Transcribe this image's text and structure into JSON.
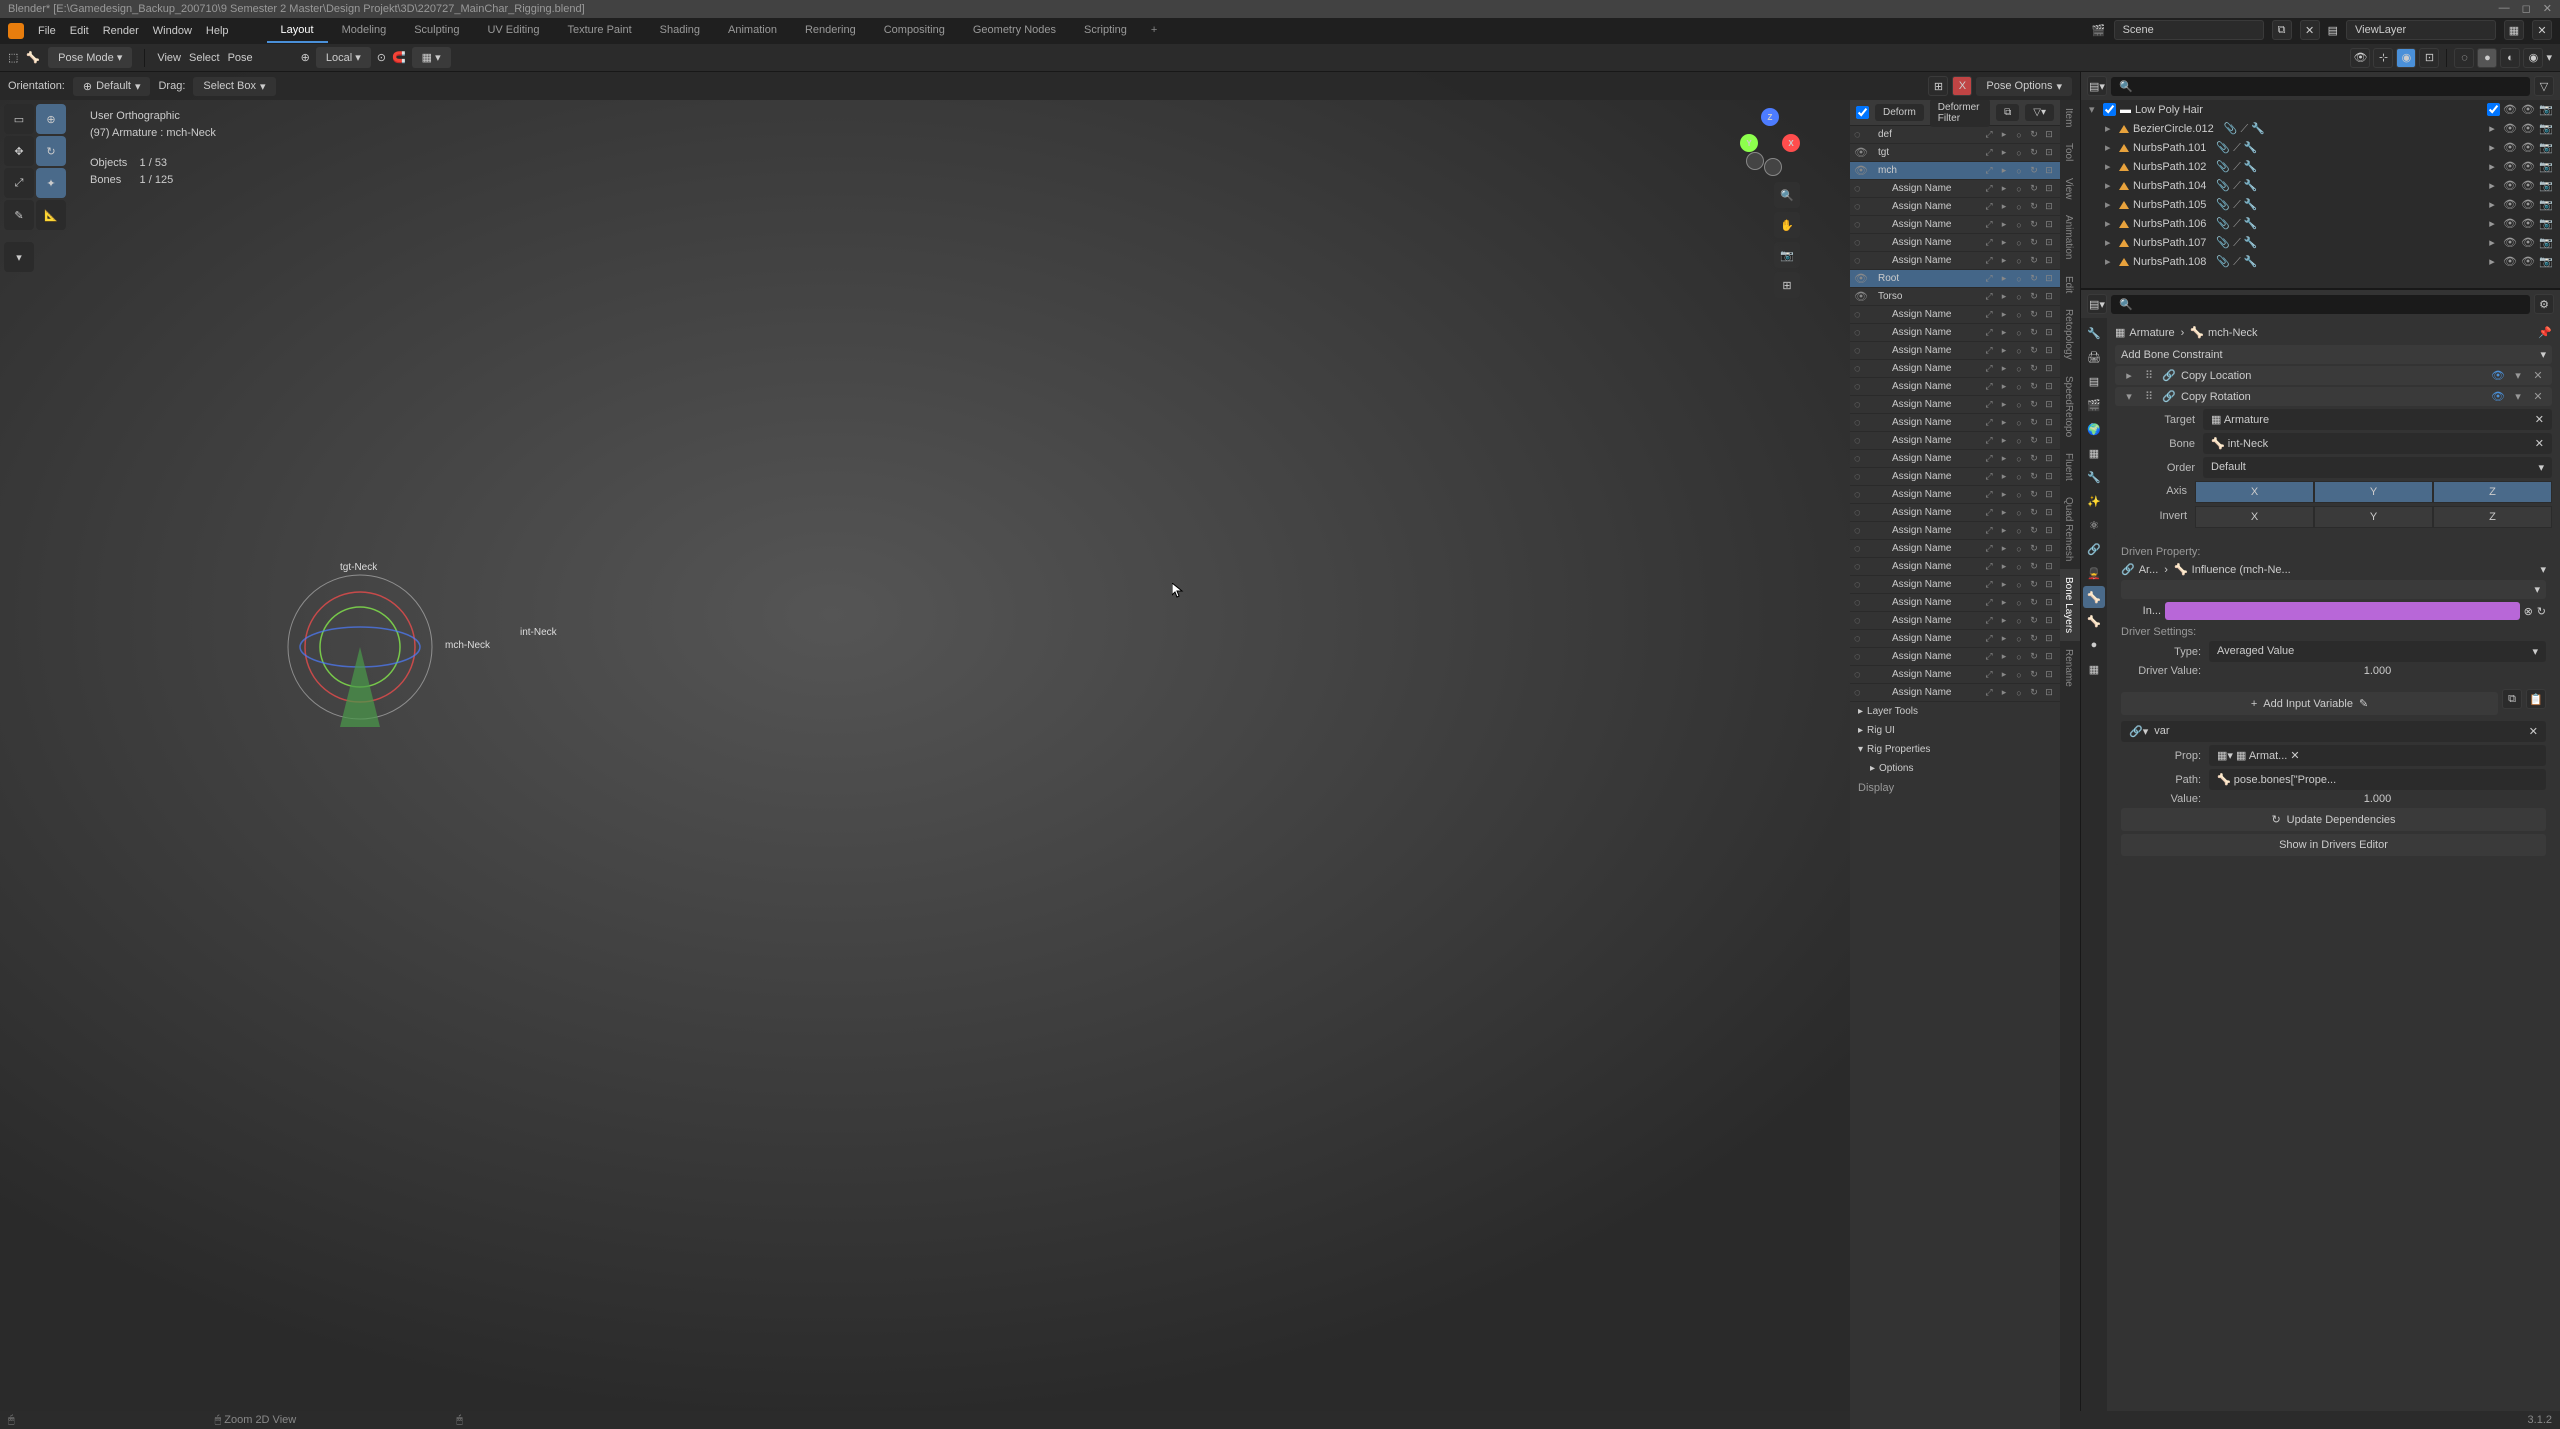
{
  "title": "Blender* [E:\\Gamedesign_Backup_200710\\9 Semester 2 Master\\Design Projekt\\3D\\220727_MainChar_Rigging.blend]",
  "menu": [
    "File",
    "Edit",
    "Render",
    "Window",
    "Help"
  ],
  "workspaces": [
    "Layout",
    "Modeling",
    "Sculpting",
    "UV Editing",
    "Texture Paint",
    "Shading",
    "Animation",
    "Rendering",
    "Compositing",
    "Geometry Nodes",
    "Scripting"
  ],
  "active_ws": "Layout",
  "scene": "Scene",
  "viewlayer": "ViewLayer",
  "header": {
    "mode": "Pose Mode",
    "menus": [
      "View",
      "Select",
      "Pose"
    ],
    "orient": "Local"
  },
  "orientbar": {
    "label": "Orientation:",
    "value": "Default",
    "drag": "Drag:",
    "dragval": "Select Box"
  },
  "n_header": {
    "deform": "Deform",
    "filter": "Deformer Filter"
  },
  "pose_options": "Pose Options",
  "vp": {
    "l1": "User Orthographic",
    "l2": "(97) Armature : mch-Neck",
    "objects_lbl": "Objects",
    "objects": "1 / 53",
    "bones_lbl": "Bones",
    "bones": "1 / 125",
    "bone_labels": [
      "tgt-Neck",
      "int-Neck",
      "mch-Neck"
    ]
  },
  "n_tabs": [
    "Item",
    "Tool",
    "View",
    "Animation",
    "Edit",
    "Retopology",
    "SpeedRetopo",
    "Fluent",
    "Quad Remesh",
    "Bone Layers",
    "Rename"
  ],
  "layers": {
    "top": [
      {
        "name": "def",
        "eye": false
      },
      {
        "name": "tgt",
        "eye": true
      },
      {
        "name": "mch",
        "eye": true,
        "sel": true
      }
    ],
    "assign_count_1": 5,
    "mid": [
      {
        "name": "Root",
        "eye": true,
        "sel": true
      },
      {
        "name": "Torso",
        "eye": true
      }
    ],
    "assign_count_2": 6,
    "assign_count_3": 8,
    "assign_count_4": 8
  },
  "assign_label": "Assign Name",
  "collapsibles": [
    "Layer Tools",
    "Rig UI",
    "Rig Properties",
    "Options"
  ],
  "display": "Display",
  "outliner": {
    "root": "Low Poly Hair",
    "items": [
      {
        "name": "BezierCircle.012",
        "type": "bez"
      },
      {
        "name": "NurbsPath.101",
        "type": "nurb"
      },
      {
        "name": "NurbsPath.102",
        "type": "nurb"
      },
      {
        "name": "NurbsPath.104",
        "type": "nurb"
      },
      {
        "name": "NurbsPath.105",
        "type": "nurb"
      },
      {
        "name": "NurbsPath.106",
        "type": "nurb"
      },
      {
        "name": "NurbsPath.107",
        "type": "nurb"
      },
      {
        "name": "NurbsPath.108",
        "type": "nurb"
      }
    ]
  },
  "props": {
    "armature": "Armature",
    "bone": "mch-Neck",
    "add": "Add Bone Constraint",
    "c1": "Copy Location",
    "c2": "Copy Rotation",
    "target_lbl": "Target",
    "target": "Armature",
    "bone_lbl": "Bone",
    "bone_val": "int-Neck",
    "order_lbl": "Order",
    "order": "Default",
    "axis_lbl": "Axis",
    "invert_lbl": "Invert",
    "axes": [
      "X",
      "Y",
      "Z"
    ],
    "infl_lbl": "In...",
    "driven": "Driven Property:",
    "bc_ar": "Ar...",
    "bc_inf": "Influence (mch-Ne...",
    "settings": "Driver Settings:",
    "type_lbl": "Type:",
    "type": "Averaged Value",
    "drvval_lbl": "Driver Value:",
    "drvval": "1.000",
    "addvar": "Add Input Variable",
    "var": "var",
    "prop_lbl": "Prop:",
    "prop": "Armat...",
    "path_lbl": "Path:",
    "path": "pose.bones[\"Prope...",
    "value_lbl": "Value:",
    "value": "1.000",
    "upd": "Update Dependencies",
    "show": "Show in Drivers Editor"
  },
  "status": {
    "zoom": "Zoom 2D View",
    "ver": "3.1.2"
  }
}
